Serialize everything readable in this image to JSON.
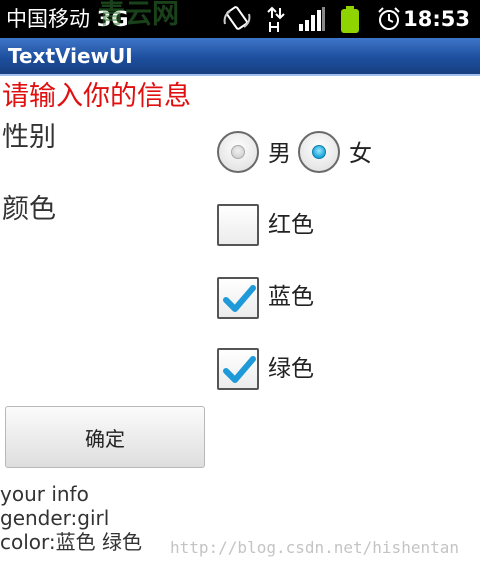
{
  "status_bar": {
    "carrier": "中国移动",
    "network": "3G",
    "watermark": "青云网",
    "time": "18:53",
    "icons": [
      "rotate-icon",
      "data-transfer-icon",
      "signal-icon",
      "battery-icon",
      "alarm-icon"
    ]
  },
  "app": {
    "title": "TextViewUI"
  },
  "form": {
    "prompt": "请输入你的信息",
    "gender": {
      "label": "性别",
      "options": [
        {
          "label": "男",
          "selected": false
        },
        {
          "label": "女",
          "selected": true
        }
      ]
    },
    "color": {
      "label": "颜色",
      "options": [
        {
          "label": "红色",
          "checked": false
        },
        {
          "label": "蓝色",
          "checked": true
        },
        {
          "label": "绿色",
          "checked": true
        }
      ]
    },
    "confirm_label": "确定"
  },
  "result": {
    "lines": [
      "your info",
      "gender:girl",
      "color:蓝色 绿色"
    ]
  },
  "watermark": "http://blog.csdn.net/hishentan",
  "colors": {
    "prompt": "#e01010",
    "title_bar": "#1d4f9e",
    "radio_selected": "#17a4d8",
    "checkmark": "#1e9ad8"
  }
}
